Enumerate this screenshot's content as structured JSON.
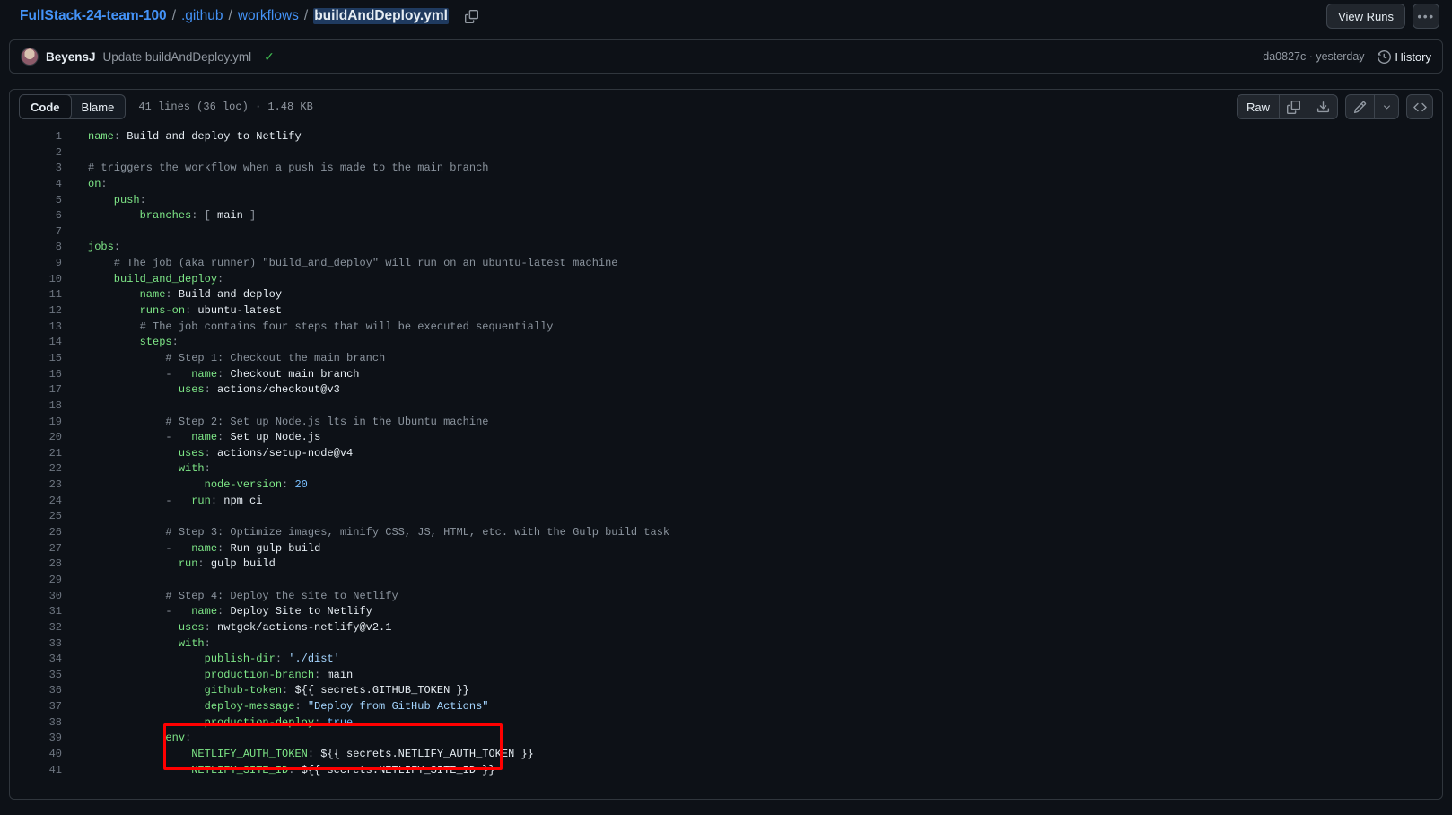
{
  "breadcrumb": {
    "repo": "FullStack-24-team-100",
    "sep": "/",
    "segments": [
      ".github",
      "workflows"
    ],
    "current_name": "buildAndDeploy",
    "current_ext": ".yml",
    "copy_icon": "copy-path-icon"
  },
  "topbar": {
    "view_runs_label": "View Runs",
    "kebab_label": "•••"
  },
  "commit": {
    "avatar_alt": "BeyensJ",
    "author": "BeyensJ",
    "message": "Update buildAndDeploy.yml",
    "status_check": "✓",
    "sha": "da0827c",
    "sha_separator": "·",
    "relative_time": "yesterday",
    "meta": "da0827c · yesterday",
    "history_label": "History",
    "history_icon": "history-clock-icon"
  },
  "file_toolbar": {
    "tabs": [
      {
        "label": "Code",
        "active": true
      },
      {
        "label": "Blame",
        "active": false
      }
    ],
    "meta": "41 lines (36 loc) · 1.48 KB",
    "lines": "41 lines",
    "loc": "(36 loc)",
    "size": "1.48 KB",
    "raw_label": "Raw",
    "copy_icon": "copy-raw-contents-icon",
    "download_icon": "download-raw-file-icon",
    "edit_icon": "pencil-edit-icon",
    "edit_caret_icon": "chevron-down-icon",
    "symbols_icon": "code-symbols-icon",
    "symbols_glyph": "⟨⟩"
  },
  "annotation": {
    "color": "#ff0000",
    "shape": "rectangle",
    "covers_lines": [
      39,
      40,
      41
    ]
  },
  "code": {
    "language": "yaml",
    "total_lines": 41,
    "lines": [
      {
        "n": 1,
        "tokens": [
          {
            "t": "k",
            "v": "name"
          },
          {
            "t": "p",
            "v": ":"
          },
          {
            "t": "s",
            "v": " Build and deploy to Netlify"
          }
        ]
      },
      {
        "n": 2,
        "tokens": []
      },
      {
        "n": 3,
        "tokens": [
          {
            "t": "c",
            "v": "# triggers the workflow when a push is made to the main branch"
          }
        ]
      },
      {
        "n": 4,
        "tokens": [
          {
            "t": "k",
            "v": "on"
          },
          {
            "t": "p",
            "v": ":"
          }
        ]
      },
      {
        "n": 5,
        "tokens": [
          {
            "t": "k",
            "v": "    push"
          },
          {
            "t": "p",
            "v": ":"
          }
        ]
      },
      {
        "n": 6,
        "tokens": [
          {
            "t": "k",
            "v": "        branches"
          },
          {
            "t": "p",
            "v": ":"
          },
          {
            "t": "s",
            "v": " "
          },
          {
            "t": "p",
            "v": "["
          },
          {
            "t": "s",
            "v": " main "
          },
          {
            "t": "p",
            "v": "]"
          }
        ]
      },
      {
        "n": 7,
        "tokens": []
      },
      {
        "n": 8,
        "tokens": [
          {
            "t": "k",
            "v": "jobs"
          },
          {
            "t": "p",
            "v": ":"
          }
        ]
      },
      {
        "n": 9,
        "tokens": [
          {
            "t": "c",
            "v": "    # The job (aka runner) \"build_and_deploy\" will run on an ubuntu-latest machine"
          }
        ]
      },
      {
        "n": 10,
        "tokens": [
          {
            "t": "k",
            "v": "    build_and_deploy"
          },
          {
            "t": "p",
            "v": ":"
          }
        ]
      },
      {
        "n": 11,
        "tokens": [
          {
            "t": "k",
            "v": "        name"
          },
          {
            "t": "p",
            "v": ":"
          },
          {
            "t": "s",
            "v": " Build and deploy"
          }
        ]
      },
      {
        "n": 12,
        "tokens": [
          {
            "t": "k",
            "v": "        runs-on"
          },
          {
            "t": "p",
            "v": ":"
          },
          {
            "t": "s",
            "v": " ubuntu-latest"
          }
        ]
      },
      {
        "n": 13,
        "tokens": [
          {
            "t": "c",
            "v": "        # The job contains four steps that will be executed sequentially"
          }
        ]
      },
      {
        "n": 14,
        "tokens": [
          {
            "t": "k",
            "v": "        steps"
          },
          {
            "t": "p",
            "v": ":"
          }
        ]
      },
      {
        "n": 15,
        "tokens": [
          {
            "t": "c",
            "v": "            # Step 1: Checkout the main branch"
          }
        ]
      },
      {
        "n": 16,
        "tokens": [
          {
            "t": "p",
            "v": "            - "
          },
          {
            "t": "k",
            "v": "  name"
          },
          {
            "t": "p",
            "v": ":"
          },
          {
            "t": "s",
            "v": " Checkout main branch"
          }
        ]
      },
      {
        "n": 17,
        "tokens": [
          {
            "t": "k",
            "v": "              uses"
          },
          {
            "t": "p",
            "v": ":"
          },
          {
            "t": "s",
            "v": " actions/checkout@v3"
          }
        ]
      },
      {
        "n": 18,
        "tokens": []
      },
      {
        "n": 19,
        "tokens": [
          {
            "t": "c",
            "v": "            # Step 2: Set up Node.js lts in the Ubuntu machine"
          }
        ]
      },
      {
        "n": 20,
        "tokens": [
          {
            "t": "p",
            "v": "            - "
          },
          {
            "t": "k",
            "v": "  name"
          },
          {
            "t": "p",
            "v": ":"
          },
          {
            "t": "s",
            "v": " Set up Node.js"
          }
        ]
      },
      {
        "n": 21,
        "tokens": [
          {
            "t": "k",
            "v": "              uses"
          },
          {
            "t": "p",
            "v": ":"
          },
          {
            "t": "s",
            "v": " actions/setup-node@v4"
          }
        ]
      },
      {
        "n": 22,
        "tokens": [
          {
            "t": "k",
            "v": "              with"
          },
          {
            "t": "p",
            "v": ":"
          }
        ]
      },
      {
        "n": 23,
        "tokens": [
          {
            "t": "k",
            "v": "                  node-version"
          },
          {
            "t": "p",
            "v": ":"
          },
          {
            "t": "n",
            "v": " 20"
          }
        ]
      },
      {
        "n": 24,
        "tokens": [
          {
            "t": "p",
            "v": "            - "
          },
          {
            "t": "k",
            "v": "  run"
          },
          {
            "t": "p",
            "v": ":"
          },
          {
            "t": "s",
            "v": " npm ci"
          }
        ]
      },
      {
        "n": 25,
        "tokens": []
      },
      {
        "n": 26,
        "tokens": [
          {
            "t": "c",
            "v": "            # Step 3: Optimize images, minify CSS, JS, HTML, etc. with the Gulp build task"
          }
        ]
      },
      {
        "n": 27,
        "tokens": [
          {
            "t": "p",
            "v": "            - "
          },
          {
            "t": "k",
            "v": "  name"
          },
          {
            "t": "p",
            "v": ":"
          },
          {
            "t": "s",
            "v": " Run gulp build"
          }
        ]
      },
      {
        "n": 28,
        "tokens": [
          {
            "t": "k",
            "v": "              run"
          },
          {
            "t": "p",
            "v": ":"
          },
          {
            "t": "s",
            "v": " gulp build"
          }
        ]
      },
      {
        "n": 29,
        "tokens": []
      },
      {
        "n": 30,
        "tokens": [
          {
            "t": "c",
            "v": "            # Step 4: Deploy the site to Netlify"
          }
        ]
      },
      {
        "n": 31,
        "tokens": [
          {
            "t": "p",
            "v": "            - "
          },
          {
            "t": "k",
            "v": "  name"
          },
          {
            "t": "p",
            "v": ":"
          },
          {
            "t": "s",
            "v": " Deploy Site to Netlify"
          }
        ]
      },
      {
        "n": 32,
        "tokens": [
          {
            "t": "k",
            "v": "              uses"
          },
          {
            "t": "p",
            "v": ":"
          },
          {
            "t": "s",
            "v": " nwtgck/actions-netlify@v2.1"
          }
        ]
      },
      {
        "n": 33,
        "tokens": [
          {
            "t": "k",
            "v": "              with"
          },
          {
            "t": "p",
            "v": ":"
          }
        ]
      },
      {
        "n": 34,
        "tokens": [
          {
            "t": "k",
            "v": "                  publish-dir"
          },
          {
            "t": "p",
            "v": ":"
          },
          {
            "t": "q",
            "v": " './dist'"
          }
        ]
      },
      {
        "n": 35,
        "tokens": [
          {
            "t": "k",
            "v": "                  production-branch"
          },
          {
            "t": "p",
            "v": ":"
          },
          {
            "t": "s",
            "v": " main"
          }
        ]
      },
      {
        "n": 36,
        "tokens": [
          {
            "t": "k",
            "v": "                  github-token"
          },
          {
            "t": "p",
            "v": ":"
          },
          {
            "t": "s",
            "v": " ${{ secrets.GITHUB_TOKEN }}"
          }
        ]
      },
      {
        "n": 37,
        "tokens": [
          {
            "t": "k",
            "v": "                  deploy-message"
          },
          {
            "t": "p",
            "v": ":"
          },
          {
            "t": "q",
            "v": " \"Deploy from GitHub Actions\""
          }
        ]
      },
      {
        "n": 38,
        "tokens": [
          {
            "t": "k",
            "v": "                  production-deploy"
          },
          {
            "t": "p",
            "v": ":"
          },
          {
            "t": "n",
            "v": " true"
          }
        ]
      },
      {
        "n": 39,
        "tokens": [
          {
            "t": "k",
            "v": "            env"
          },
          {
            "t": "p",
            "v": ":"
          }
        ]
      },
      {
        "n": 40,
        "tokens": [
          {
            "t": "k",
            "v": "                NETLIFY_AUTH_TOKEN"
          },
          {
            "t": "p",
            "v": ":"
          },
          {
            "t": "s",
            "v": " ${{ secrets.NETLIFY_AUTH_TOKEN }}"
          }
        ]
      },
      {
        "n": 41,
        "tokens": [
          {
            "t": "k",
            "v": "                NETLIFY_SITE_ID"
          },
          {
            "t": "p",
            "v": ":"
          },
          {
            "t": "s",
            "v": " ${{ secrets.NETLIFY_SITE_ID }}"
          }
        ]
      }
    ]
  }
}
